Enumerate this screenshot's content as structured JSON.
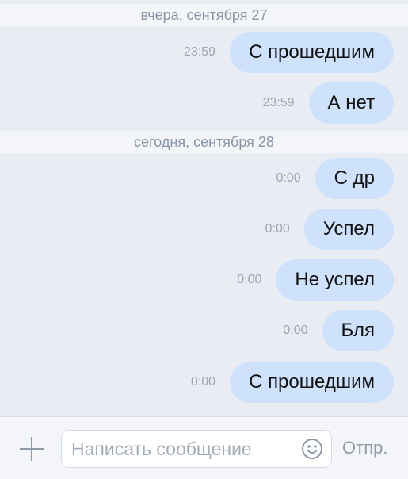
{
  "separators": [
    {
      "label": "вчера, сентября 27"
    },
    {
      "label": "сегодня, сентября 28"
    }
  ],
  "messages": [
    {
      "time": "23:59",
      "text": "С прошедшим"
    },
    {
      "time": "23:59",
      "text": "А нет"
    },
    {
      "time": "0:00",
      "text": "С др"
    },
    {
      "time": "0:00",
      "text": "Успел"
    },
    {
      "time": "0:00",
      "text": "Не успел"
    },
    {
      "time": "0:00",
      "text": "Бля"
    },
    {
      "time": "0:00",
      "text": "С прошедшим"
    }
  ],
  "composer": {
    "attach_icon": "plus-icon",
    "placeholder": "Написать сообщение",
    "emoji_icon": "smile-icon",
    "send_label": "Отпр."
  },
  "colors": {
    "background": "#e9edf3",
    "bubble": "#cfe2fb",
    "separator": "#f3f5f9",
    "muted_text": "#8a96a6"
  }
}
